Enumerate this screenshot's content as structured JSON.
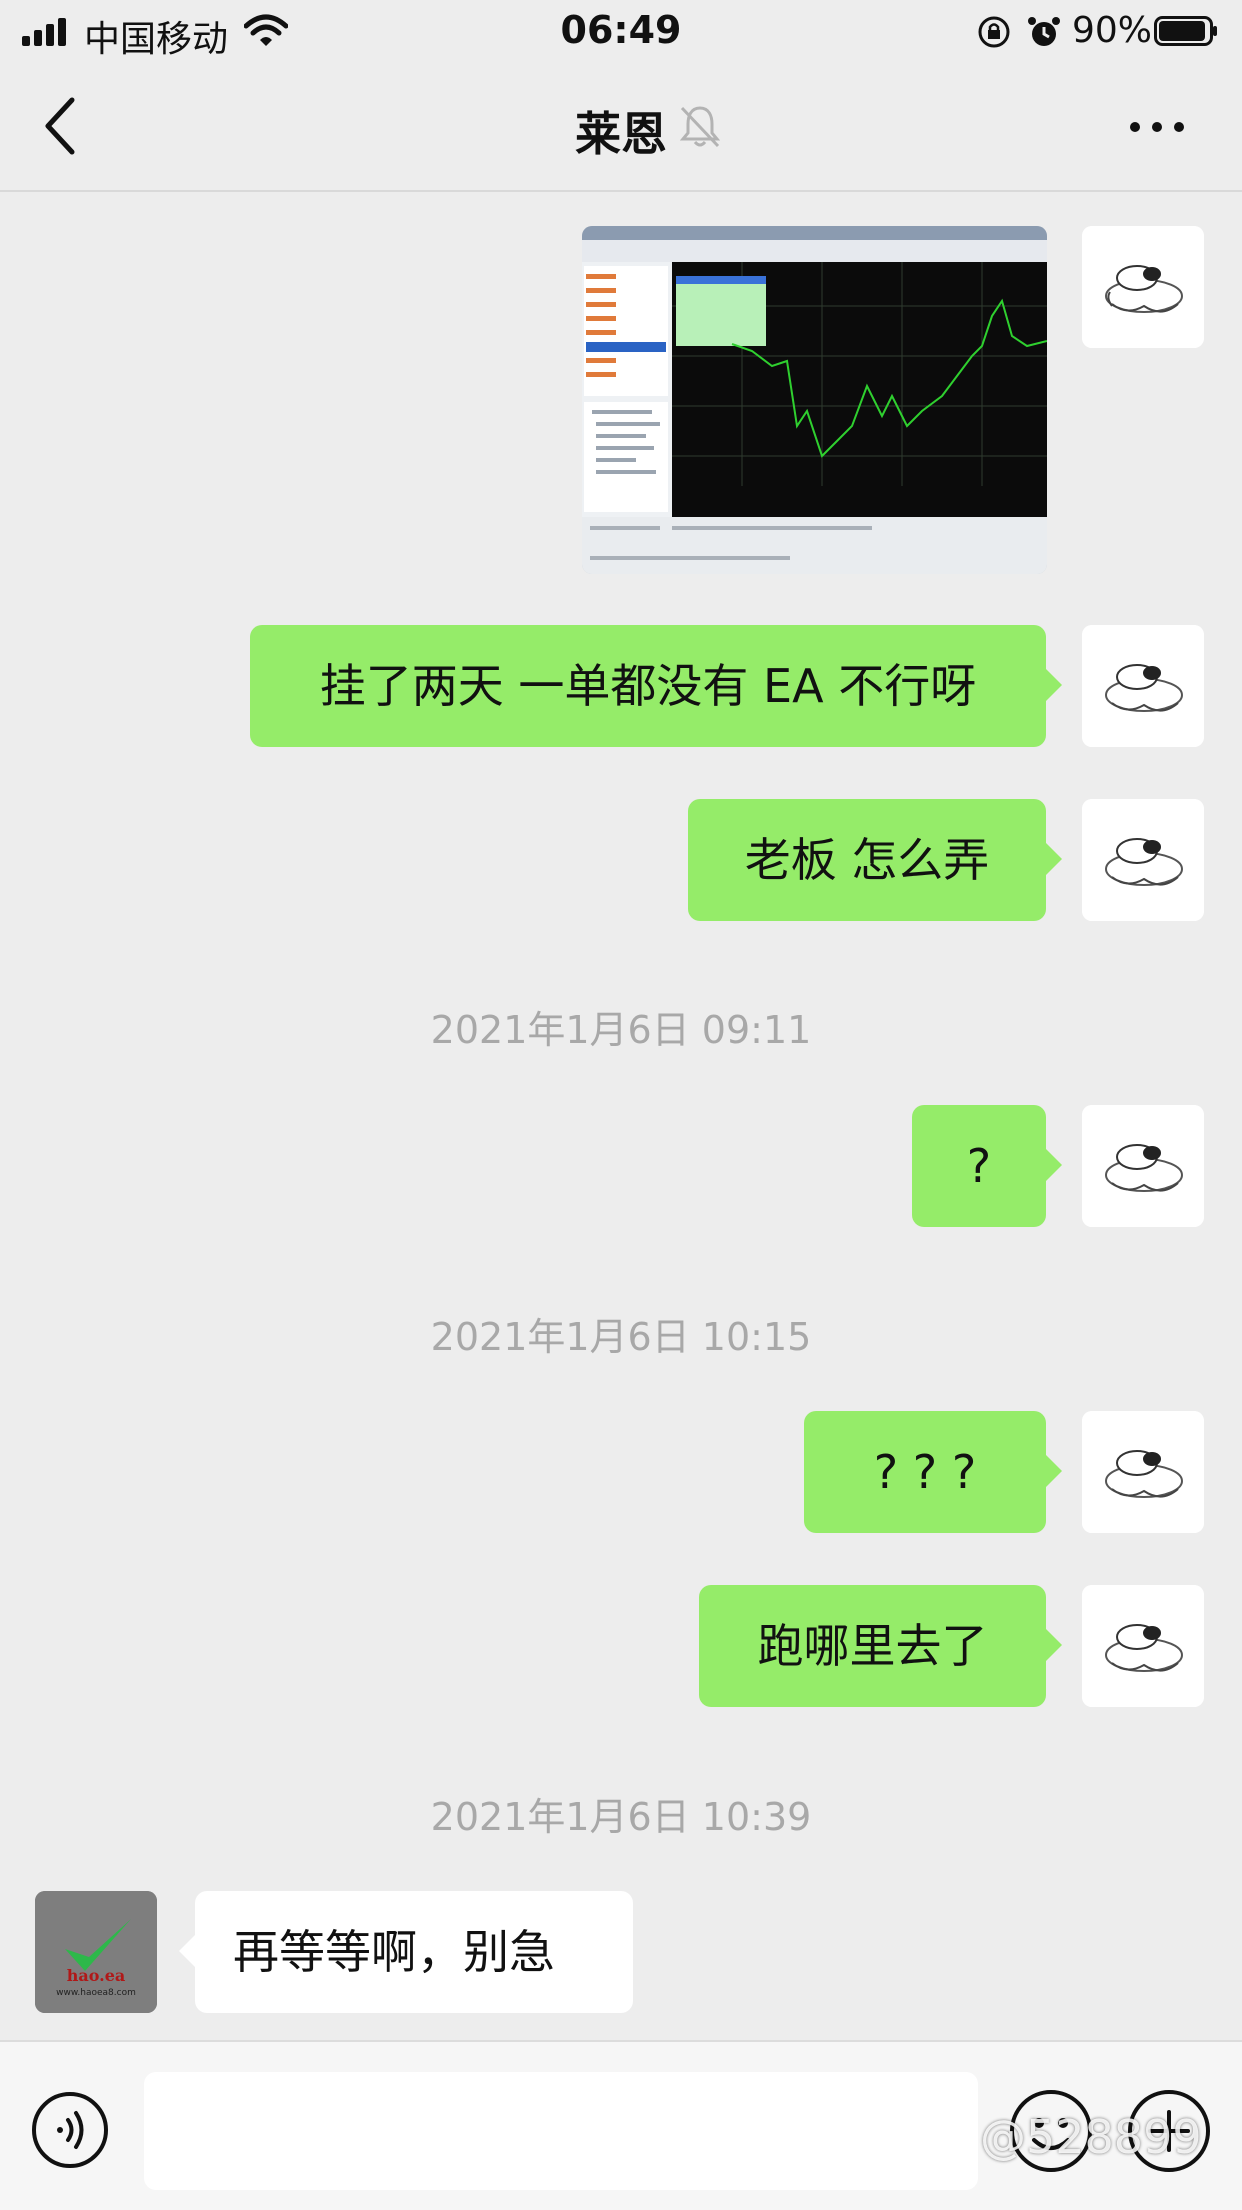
{
  "status_bar": {
    "carrier": "中国移动",
    "time": "06:49",
    "battery": "90%"
  },
  "nav": {
    "title": "莱恩",
    "icons": [
      "back-chevron-icon",
      "mute-bell-icon",
      "more-dots-icon"
    ]
  },
  "messages": [
    {
      "type": "image",
      "sender": "self",
      "description_icon": "trading-chart-photo"
    },
    {
      "type": "text",
      "sender": "self",
      "text": "挂了两天 一单都没有 EA 不行呀"
    },
    {
      "type": "text",
      "sender": "self",
      "text": "老板 怎么弄"
    },
    {
      "type": "time",
      "text": "2021年1月6日 09:11"
    },
    {
      "type": "text",
      "sender": "self",
      "text": "?"
    },
    {
      "type": "time",
      "text": "2021年1月6日 10:15"
    },
    {
      "type": "text",
      "sender": "self",
      "text": "? ? ?"
    },
    {
      "type": "text",
      "sender": "self",
      "text": "跑哪里去了"
    },
    {
      "type": "time",
      "text": "2021年1月6日 10:39"
    },
    {
      "type": "text",
      "sender": "other",
      "text": "再等等啊，别急"
    }
  ],
  "other_avatar": {
    "logo_text": "hao.ea",
    "url_text": "www.haoea8.com"
  },
  "input": {
    "placeholder": ""
  },
  "watermark": "@528899",
  "colors": {
    "bubble_self": "#95ec69",
    "bubble_other": "#ffffff",
    "background": "#ededed"
  }
}
